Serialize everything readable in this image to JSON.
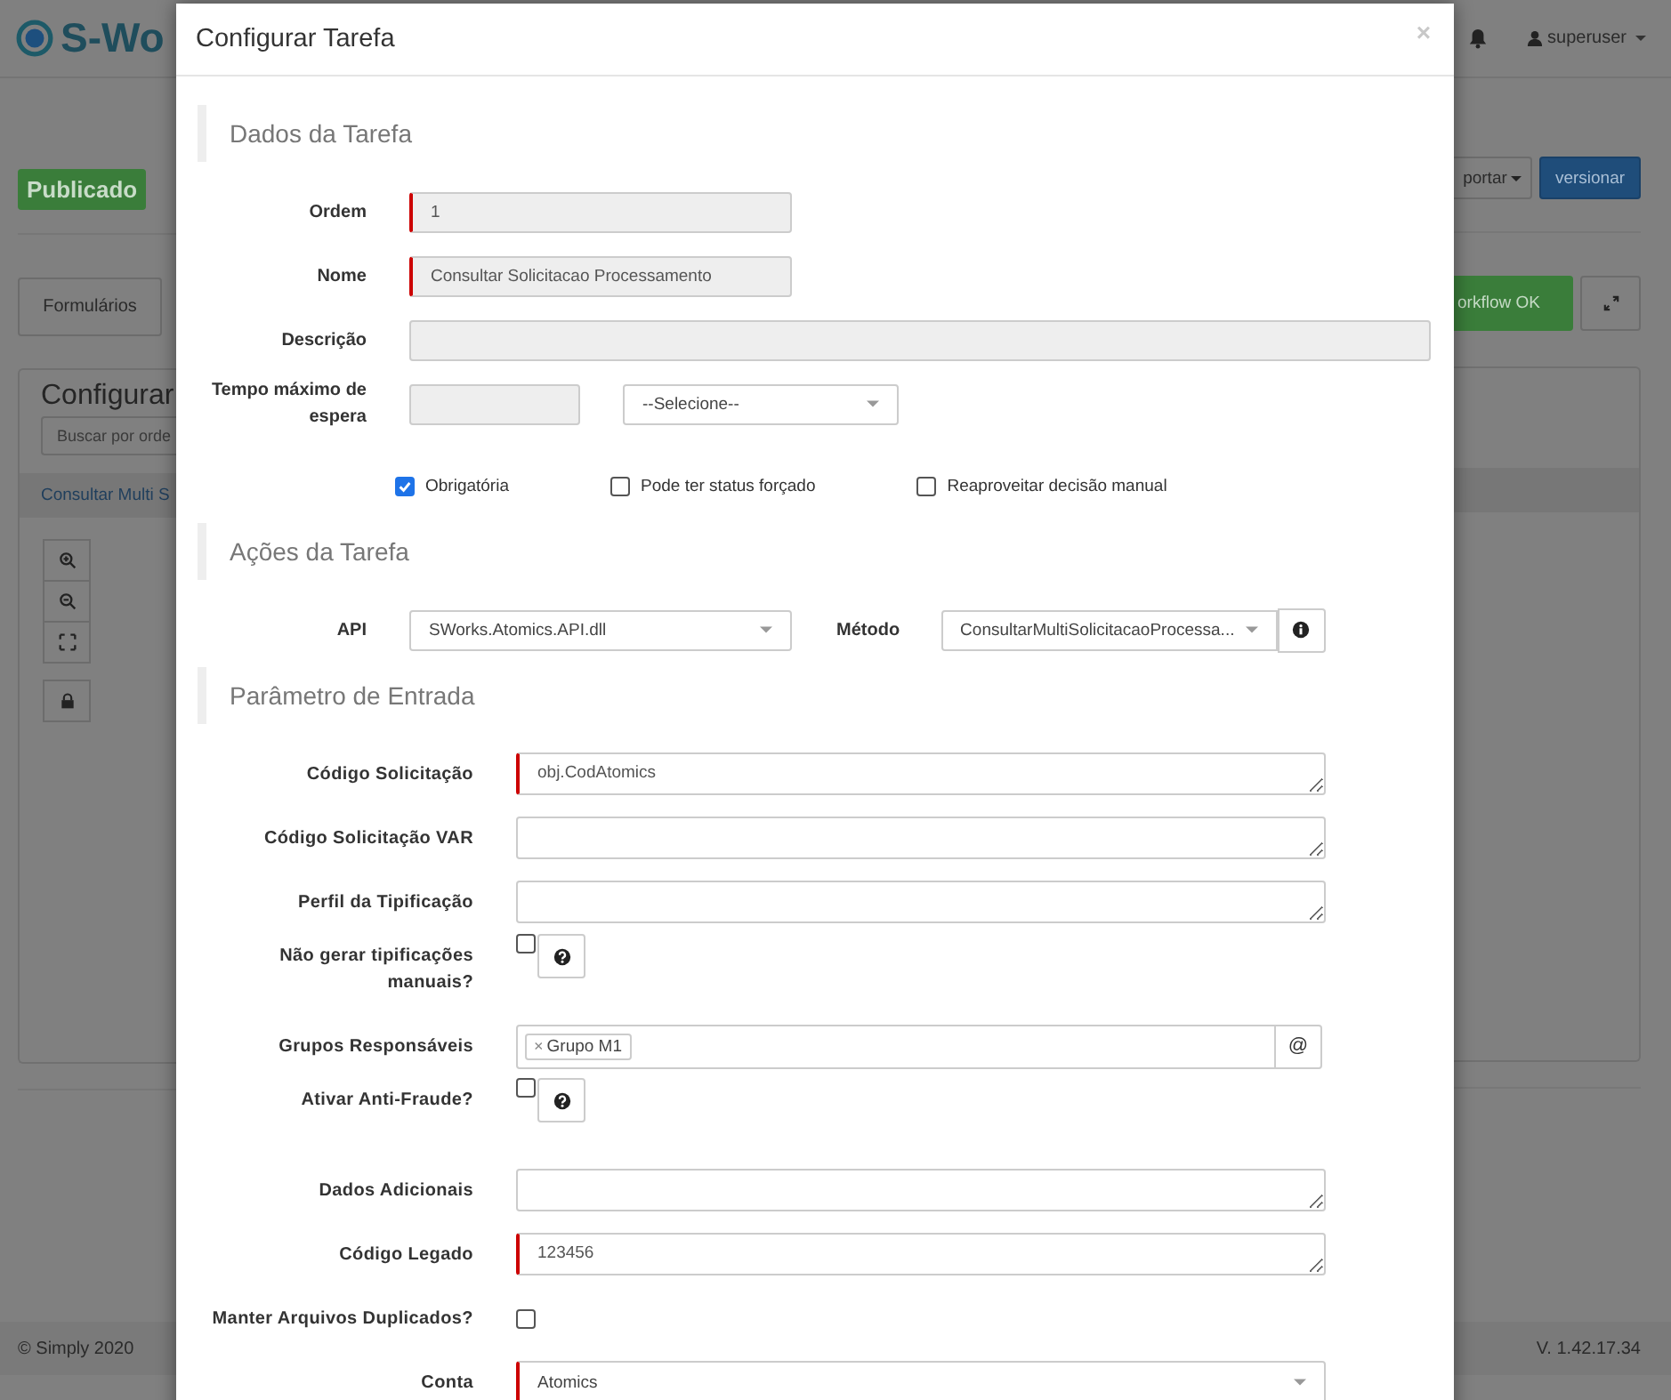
{
  "background": {
    "logo_text": "S-Wo",
    "status_badge": "Publicado",
    "tab_button": "Formulários",
    "panel": {
      "title": "Configurar",
      "search": {
        "placeholder": "Buscar por orde"
      },
      "list_item": "Consultar Multi S"
    },
    "user": "superuser",
    "export_button": "portar",
    "version_button": "versionar",
    "workflow_button": "orkflow OK",
    "footer": {
      "copyright": "© Simply 2020",
      "version": "V. 1.42.17.34"
    }
  },
  "modal": {
    "title": "Configurar Tarefa",
    "close": "×",
    "sections": [
      {
        "title": "Dados da Tarefa",
        "rows": [
          {
            "kind": "input",
            "label": "Ordem",
            "value": "1",
            "required": true,
            "disabled": true
          },
          {
            "kind": "input",
            "label": "Nome",
            "value": "Consultar Solicitacao Processamento",
            "required": true,
            "disabled": true
          },
          {
            "kind": "wide_input",
            "label": "Descrição",
            "required": false,
            "disabled": true
          },
          {
            "kind": "input_select",
            "label": "Tempo máximo de espera",
            "select": "--Selecione--",
            "required": false,
            "disabled": true
          },
          {
            "kind": "checks",
            "items": [
              {
                "label": "Obrigatória",
                "checked": true
              },
              {
                "label": "Pode ter status forçado",
                "checked": false
              },
              {
                "label": "Reaproveitar decisão manual",
                "checked": false
              }
            ]
          }
        ]
      },
      {
        "title": "Ações da Tarefa",
        "rows": [
          {
            "kind": "api",
            "label": "API",
            "value": "SWorks.Atomics.API.dll",
            "method_label": "Método",
            "method_value": "ConsultarMultiSolicitacaoProcessa..."
          }
        ]
      },
      {
        "title": "Parâmetro de Entrada",
        "rows": [
          {
            "kind": "textarea",
            "label": "Código Solicitação",
            "value": "obj.CodAtomics",
            "required": true
          },
          {
            "kind": "textarea",
            "label": "Código Solicitação VAR",
            "required": false
          },
          {
            "kind": "textarea",
            "label": "Perfil da Tipificação",
            "required": false
          },
          {
            "kind": "check_help",
            "label": "Não gerar tipificações manuais?",
            "checked": false
          },
          {
            "kind": "tags",
            "label": "Grupos Responsáveis",
            "tags": [
              {
                "remove": "×",
                "label": "Grupo M1"
              }
            ],
            "addon": "@"
          },
          {
            "kind": "check_help",
            "label": "Ativar Anti-Fraude?",
            "checked": false
          },
          {
            "kind": "textarea",
            "label": "Dados Adicionais",
            "required": false
          },
          {
            "kind": "textarea",
            "label": "Código Legado",
            "value": "123456",
            "required": true
          },
          {
            "kind": "check",
            "label": "Manter Arquivos Duplicados?",
            "checked": false
          },
          {
            "kind": "select",
            "label": "Conta",
            "value": "Atomics",
            "required": true
          }
        ]
      }
    ]
  }
}
